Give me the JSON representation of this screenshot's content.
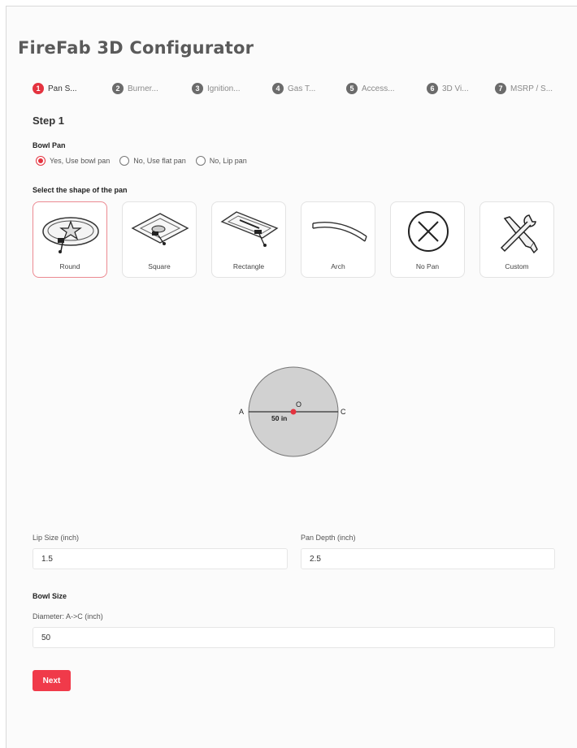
{
  "app": {
    "title": "FireFab 3D Configurator"
  },
  "stepper": [
    {
      "num": "1",
      "label": "Pan S...",
      "active": true
    },
    {
      "num": "2",
      "label": "Burner...",
      "active": false
    },
    {
      "num": "3",
      "label": "Ignition...",
      "active": false
    },
    {
      "num": "4",
      "label": "Gas T...",
      "active": false
    },
    {
      "num": "5",
      "label": "Access...",
      "active": false
    },
    {
      "num": "6",
      "label": "3D Vi...",
      "active": false
    },
    {
      "num": "7",
      "label": "MSRP / S...",
      "active": false
    }
  ],
  "step_heading": "Step 1",
  "bowl_pan": {
    "label": "Bowl Pan",
    "options": [
      {
        "label": "Yes, Use bowl pan",
        "checked": true
      },
      {
        "label": "No, Use flat pan",
        "checked": false
      },
      {
        "label": "No, Lip pan",
        "checked": false
      }
    ]
  },
  "shape_section": {
    "label": "Select the shape of the pan",
    "shapes": [
      {
        "label": "Round",
        "icon": "round-pan-icon",
        "selected": true
      },
      {
        "label": "Square",
        "icon": "square-pan-icon",
        "selected": false
      },
      {
        "label": "Rectangle",
        "icon": "rectangle-pan-icon",
        "selected": false
      },
      {
        "label": "Arch",
        "icon": "arch-pan-icon",
        "selected": false
      },
      {
        "label": "No Pan",
        "icon": "no-pan-icon",
        "selected": false
      },
      {
        "label": "Custom",
        "icon": "tools-icon",
        "selected": false
      }
    ]
  },
  "diagram": {
    "label_a": "A",
    "label_c": "C",
    "label_o": "O",
    "dimension": "50 in",
    "fill_color": "#d1d1d1",
    "center_color": "#e4333f"
  },
  "lip_size": {
    "label": "Lip Size (inch)",
    "value": "1.5"
  },
  "pan_depth": {
    "label": "Pan Depth (inch)",
    "value": "2.5"
  },
  "bowl_size": {
    "label": "Bowl Size",
    "diameter_label": "Diameter: A->C (inch)",
    "diameter_value": "50"
  },
  "next_button": {
    "label": "Next",
    "color": "#f03a4a"
  },
  "accent_color": "#e4333f"
}
